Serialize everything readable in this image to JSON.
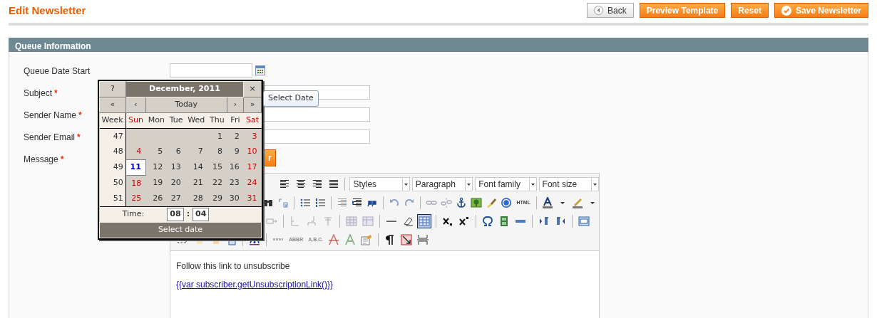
{
  "page": {
    "title": "Edit Newsletter"
  },
  "actions": [
    {
      "label": "Back",
      "kind": "back"
    },
    {
      "label": "Preview Template",
      "kind": "primary"
    },
    {
      "label": "Reset",
      "kind": "primary"
    },
    {
      "label": "Save Newsletter",
      "kind": "save"
    }
  ],
  "section": {
    "title": "Queue Information"
  },
  "fields": [
    {
      "label": "Queue Date Start",
      "required": false,
      "kind": "date"
    },
    {
      "label": "Subject",
      "required": true,
      "kind": "text"
    },
    {
      "label": "Sender Name",
      "required": true,
      "kind": "text"
    },
    {
      "label": "Sender Email",
      "required": true,
      "kind": "text"
    },
    {
      "label": "Message",
      "required": true,
      "kind": "editor"
    }
  ],
  "required_mark": "*",
  "editor": {
    "toggle_button": {
      "label": "r"
    },
    "selects": [
      "Styles",
      "Paragraph",
      "Font family",
      "Font size"
    ],
    "visual_aid": {
      "selected": true
    },
    "icon_labels": {
      "html": "HTML",
      "abbr": "ABBR",
      "acronym": "A.B.C."
    },
    "content": {
      "paragraph": "Follow this link to unsubscribe",
      "link": "{{var subscriber.getUnsubscriptionLink()}}"
    }
  },
  "calendar": {
    "help": "?",
    "title": "December, 2011",
    "close": "×",
    "nav": [
      {
        "label": "«",
        "kind": "arrow"
      },
      {
        "label": "‹",
        "kind": "arrow"
      },
      {
        "label": "Today",
        "kind": "today"
      },
      {
        "label": "›",
        "kind": "arrow"
      },
      {
        "label": "»",
        "kind": "arrow"
      }
    ],
    "week_label": "Week",
    "weekdays": [
      {
        "label": "Sun",
        "weekend": true
      },
      {
        "label": "Mon",
        "weekend": false
      },
      {
        "label": "Tue",
        "weekend": false
      },
      {
        "label": "Wed",
        "weekend": false
      },
      {
        "label": "Thu",
        "weekend": false
      },
      {
        "label": "Fri",
        "weekend": false
      },
      {
        "label": "Sat",
        "weekend": true
      }
    ],
    "weeks": [
      {
        "number": "47",
        "days": [
          {
            "day": "1",
            "selected": false
          },
          {
            "day": "2",
            "selected": false
          },
          {
            "day": "3",
            "selected": false
          }
        ]
      },
      {
        "number": "48",
        "days": [
          {
            "day": "4",
            "selected": false
          },
          {
            "day": "5",
            "selected": false
          },
          {
            "day": "6",
            "selected": false
          },
          {
            "day": "7",
            "selected": false
          },
          {
            "day": "8",
            "selected": false
          },
          {
            "day": "9",
            "selected": false
          },
          {
            "day": "10",
            "selected": false
          }
        ]
      },
      {
        "number": "49",
        "days": [
          {
            "day": "11",
            "selected": true
          },
          {
            "day": "12",
            "selected": false
          },
          {
            "day": "13",
            "selected": false
          },
          {
            "day": "14",
            "selected": false
          },
          {
            "day": "15",
            "selected": false
          },
          {
            "day": "16",
            "selected": false
          },
          {
            "day": "17",
            "selected": false
          }
        ]
      },
      {
        "number": "50",
        "days": [
          {
            "day": "18",
            "selected": false
          },
          {
            "day": "19",
            "selected": false
          },
          {
            "day": "20",
            "selected": false
          },
          {
            "day": "21",
            "selected": false
          },
          {
            "day": "22",
            "selected": false
          },
          {
            "day": "23",
            "selected": false
          },
          {
            "day": "24",
            "selected": false
          }
        ]
      },
      {
        "number": "51",
        "days": [
          {
            "day": "25",
            "selected": false
          },
          {
            "day": "26",
            "selected": false
          },
          {
            "day": "27",
            "selected": false
          },
          {
            "day": "28",
            "selected": false
          },
          {
            "day": "29",
            "selected": false
          },
          {
            "day": "30",
            "selected": false
          },
          {
            "day": "31",
            "selected": false
          }
        ]
      }
    ],
    "time_label": "Time:",
    "hours": "08",
    "separator": ":",
    "minutes": "04",
    "footer": "Select date"
  },
  "tooltip": {
    "label": "Select Date"
  }
}
